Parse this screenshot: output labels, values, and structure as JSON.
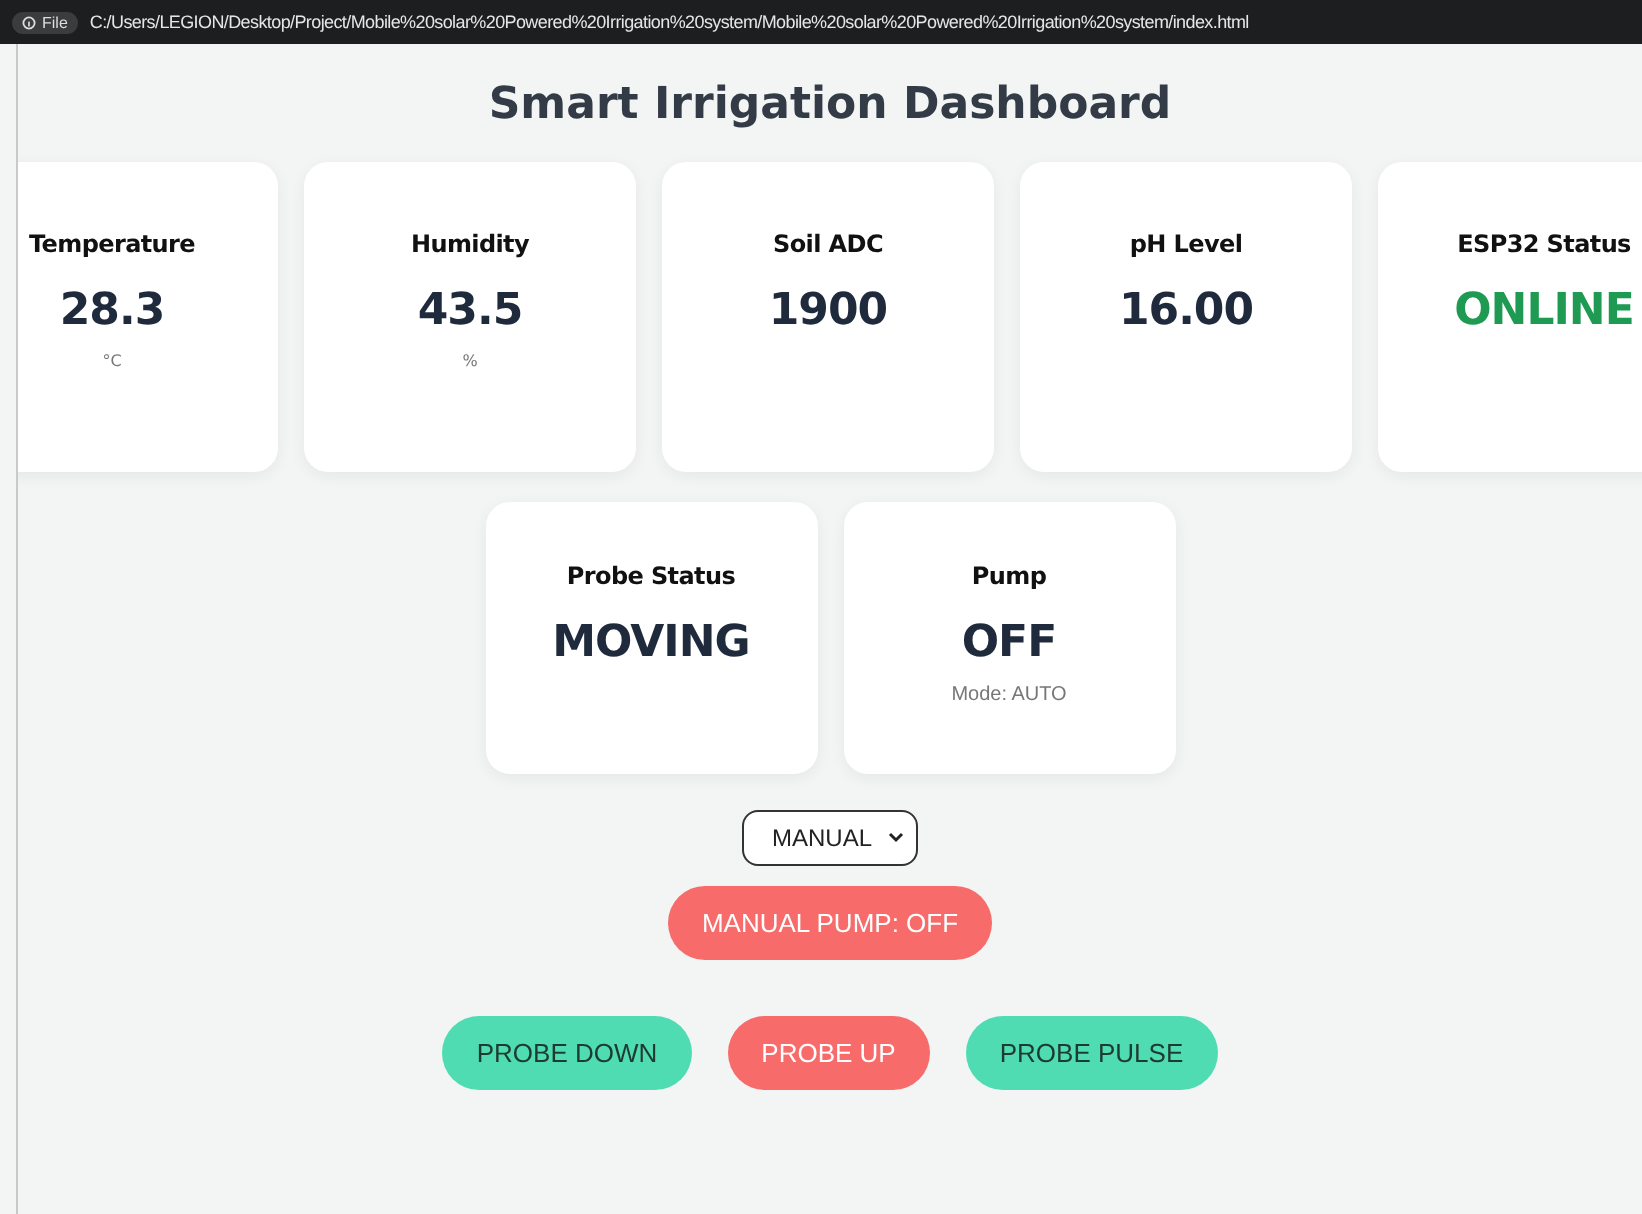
{
  "address_bar": {
    "badge": "File",
    "url": "C:/Users/LEGION/Desktop/Project/Mobile%20solar%20Powered%20Irrigation%20system/Mobile%20solar%20Powered%20Irrigation%20system/index.html"
  },
  "title": "Smart Irrigation Dashboard",
  "cards": [
    {
      "label": "Temperature",
      "value": "28.3",
      "unit": "°C",
      "color": "#1f2a3c"
    },
    {
      "label": "Humidity",
      "value": "43.5",
      "unit": "%",
      "color": "#1f2a3c"
    },
    {
      "label": "Soil ADC",
      "value": "1900",
      "color": "#1f2a3c"
    },
    {
      "label": "pH Level",
      "value": "16.00",
      "color": "#1f2a3c"
    },
    {
      "label": "ESP32 Status",
      "value": "ONLINE",
      "color": "#1e9a52"
    }
  ],
  "status_cards": [
    {
      "label": "Probe Status",
      "value": "MOVING"
    },
    {
      "label": "Pump",
      "value": "OFF",
      "note": "Mode: AUTO"
    }
  ],
  "mode_select": {
    "value": "MANUAL"
  },
  "pump_button": {
    "label": "MANUAL PUMP: OFF",
    "color": "#f76b6b"
  },
  "probe_buttons": [
    {
      "label": "PROBE DOWN",
      "color": "#4fdcb2"
    },
    {
      "label": "PROBE UP",
      "color": "#f76b6b"
    },
    {
      "label": "PROBE PULSE",
      "color": "#4fdcb2"
    }
  ]
}
